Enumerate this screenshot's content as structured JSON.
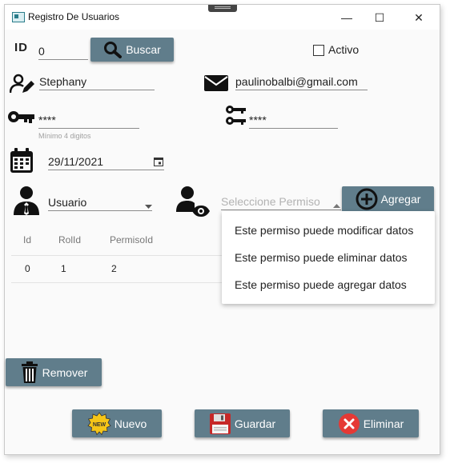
{
  "window": {
    "title": "Registro De Usuarios",
    "minimize": "—",
    "maximize": "☐",
    "close": "✕"
  },
  "form": {
    "id_label": "ID",
    "id_value": "0",
    "buscar_label": "Buscar",
    "activo_label": "Activo",
    "activo_checked": false,
    "nombre_value": "Stephany",
    "email_value": "paulinobalbi@gmail.com",
    "password_value": "****",
    "password_hint": "Mínimo 4 digitos",
    "confirm_value": "****",
    "fecha_value": "29/11/2021",
    "rol_value": "Usuario",
    "permiso_placeholder": "Seleccione Permiso",
    "agregar_label": "Agregar"
  },
  "permisos_dropdown": {
    "items": [
      "Este permiso puede modificar datos",
      "Este permiso puede eliminar datos",
      "Este permiso puede agregar datos"
    ]
  },
  "table": {
    "headers": [
      "Id",
      "RolId",
      "PermisoId"
    ],
    "rows": [
      [
        "0",
        "1",
        "2"
      ]
    ]
  },
  "actions": {
    "remover_label": "Remover",
    "nuevo_label": "Nuevo",
    "guardar_label": "Guardar",
    "eliminar_label": "Eliminar"
  },
  "colors": {
    "button_bg": "#607d8b",
    "accent_red": "#e53935",
    "icon_dark": "#1b1b1b"
  }
}
